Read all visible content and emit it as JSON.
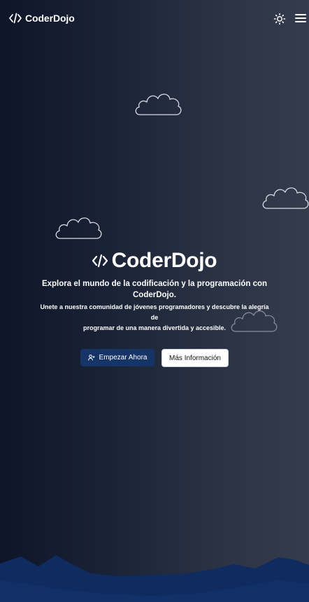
{
  "header": {
    "brand_icon": "code-icon",
    "brand_name": "CoderDojo",
    "theme_toggle_icon": "sun-icon",
    "menu_icon": "hamburger-menu-icon"
  },
  "hero": {
    "logo_icon": "code-icon",
    "title": "CoderDojo",
    "tagline": "Explora el mundo de la codificación y la programación con CoderDojo.",
    "description_line1": "Unete a nuestra comunidad de jóvenes programadores y descubre la alegría de",
    "description_line2": "programar de una manera divertida y accesible."
  },
  "actions": {
    "primary_icon": "user-plus-icon",
    "primary_label": "Empezar Ahora",
    "secondary_label": "Más Información"
  },
  "colors": {
    "background_dark": "#0e1528",
    "background_light": "#343c4d",
    "primary_button": "#173468",
    "mountains": "#0f2b5f",
    "cloud_outline": "#d8dce3"
  }
}
